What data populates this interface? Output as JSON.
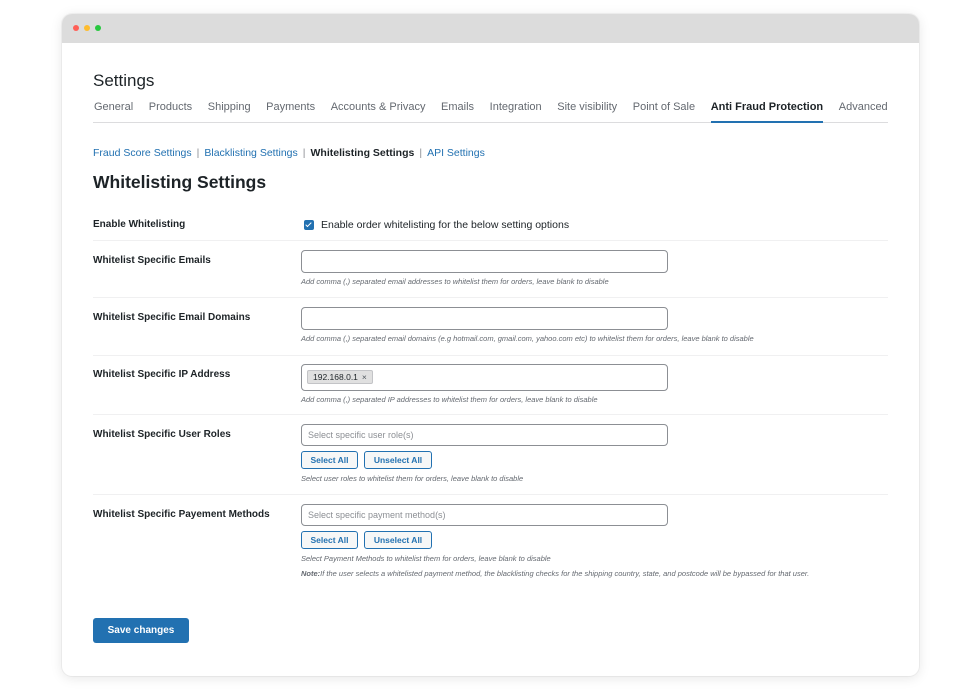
{
  "window": {
    "controls": [
      "close",
      "minimize",
      "maximize"
    ]
  },
  "page": {
    "heading": "Settings"
  },
  "tabs": [
    {
      "label": "General"
    },
    {
      "label": "Products"
    },
    {
      "label": "Shipping"
    },
    {
      "label": "Payments"
    },
    {
      "label": "Accounts & Privacy"
    },
    {
      "label": "Emails"
    },
    {
      "label": "Integration"
    },
    {
      "label": "Site visibility"
    },
    {
      "label": "Point of Sale"
    },
    {
      "label": "Anti Fraud Protection",
      "active": true
    },
    {
      "label": "Advanced"
    }
  ],
  "subnav": {
    "items": [
      {
        "label": "Fraud Score Settings"
      },
      {
        "label": "Blacklisting Settings"
      },
      {
        "label": "Whitelisting Settings",
        "current": true
      },
      {
        "label": "API Settings"
      }
    ],
    "separator": "|"
  },
  "section": {
    "title": "Whitelisting Settings"
  },
  "form": {
    "enable": {
      "label": "Enable Whitelisting",
      "checked": true,
      "checkbox_label": "Enable order whitelisting for the below setting options"
    },
    "emails": {
      "label": "Whitelist Specific Emails",
      "value": "",
      "description": "Add comma (,) separated email addresses to whitelist them for orders, leave blank to disable"
    },
    "domains": {
      "label": "Whitelist Specific Email Domains",
      "value": "",
      "description": "Add comma (,) separated email domains (e.g hotmail.com, gmail.com, yahoo.com etc) to whitelist them for orders, leave blank to disable"
    },
    "ip": {
      "label": "Whitelist Specific IP Address",
      "tags": [
        "192.168.0.1"
      ],
      "tag_remove": "×",
      "description": "Add comma (,) separated IP addresses to whitelist them for orders, leave blank to disable"
    },
    "roles": {
      "label": "Whitelist Specific User Roles",
      "placeholder": "Select specific user role(s)",
      "select_all": "Select All",
      "unselect_all": "Unselect All",
      "description": "Select user roles to whitelist them for orders, leave blank to disable"
    },
    "payments": {
      "label": "Whitelist Specific Payement Methods",
      "placeholder": "Select specific payment method(s)",
      "select_all": "Select All",
      "unselect_all": "Unselect All",
      "description": "Select Payment Methods to whitelist them for orders, leave blank to disable",
      "note_label": "Note:",
      "note_text": "If the user selects a whitelisted payment method, the blacklisting checks for the shipping country, state, and postcode will be bypassed for that user."
    }
  },
  "actions": {
    "save_label": "Save changes"
  },
  "colors": {
    "accent": "#2271b1",
    "text": "#1d2327",
    "muted": "#646970"
  }
}
